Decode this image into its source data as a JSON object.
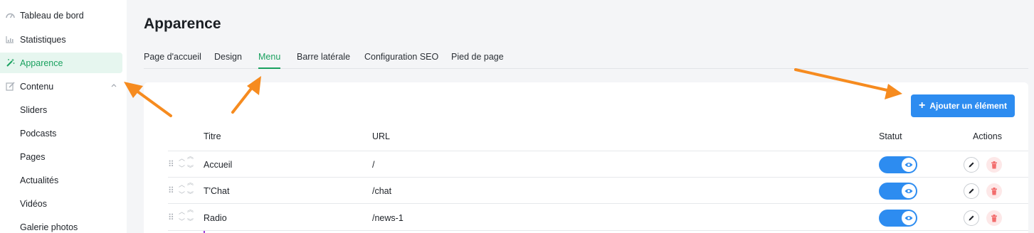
{
  "sidebar": {
    "items": [
      {
        "label": "Tableau de bord",
        "icon": "dashboard-icon"
      },
      {
        "label": "Statistiques",
        "icon": "chart-icon"
      },
      {
        "label": "Apparence",
        "icon": "magic-wand-icon",
        "active": true
      },
      {
        "label": "Contenu",
        "icon": "edit-icon",
        "expanded": true
      }
    ],
    "sub_items": [
      "Sliders",
      "Podcasts",
      "Pages",
      "Actualités",
      "Vidéos",
      "Galerie photos"
    ]
  },
  "page": {
    "title": "Apparence",
    "tabs": [
      {
        "label": "Page d'accueil"
      },
      {
        "label": "Design"
      },
      {
        "label": "Menu",
        "active": true
      },
      {
        "label": "Barre latérale"
      },
      {
        "label": "Configuration SEO"
      },
      {
        "label": "Pied de page"
      }
    ]
  },
  "toolbar": {
    "add_label": "Ajouter un élément"
  },
  "table": {
    "headers": {
      "title": "Titre",
      "url": "URL",
      "status": "Statut",
      "actions": "Actions"
    },
    "rows": [
      {
        "title": "Accueil",
        "url": "/",
        "status": true
      },
      {
        "title": "T'Chat",
        "url": "/chat",
        "status": true
      },
      {
        "title": "Radio",
        "url": "/news-1",
        "status": true
      }
    ]
  },
  "colors": {
    "accent_green": "#1aa15f",
    "primary_blue": "#2d8cf0",
    "annotation_arrow": "#f68b1f",
    "danger": "#f26d6d"
  }
}
